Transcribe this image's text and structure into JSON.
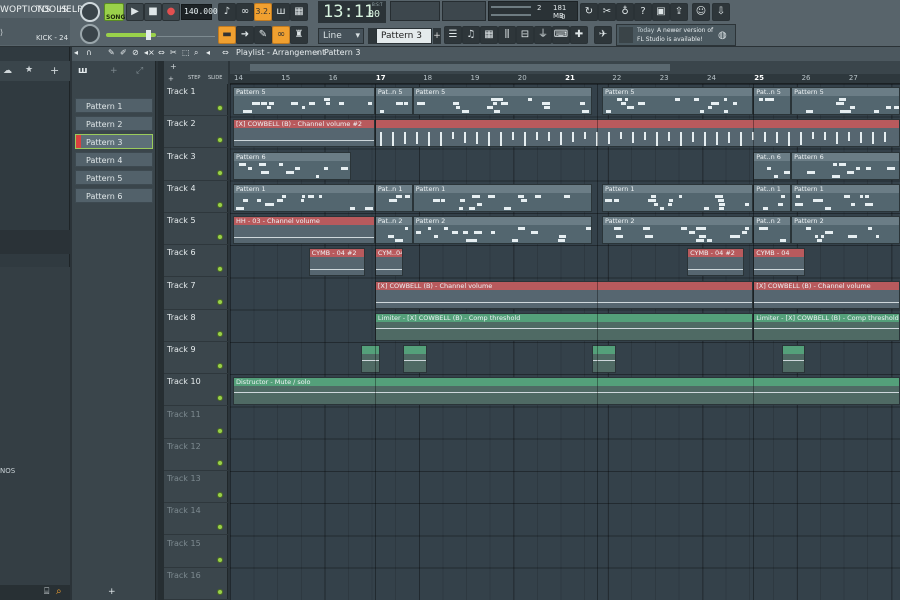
{
  "menu": {
    "view": "W",
    "options": "OPTIONS",
    "tools": "TOOLS",
    "help": "HELP"
  },
  "transport": {
    "song_label": "SONG",
    "tempo": "140.000",
    "time": "13:11",
    "time_sub": "00",
    "time_unit": "B:S:T"
  },
  "monitor": {
    "voices": "2",
    "memory": "181 MB",
    "cpu_val": "0"
  },
  "hint_bar": {
    "channel": "KICK - 24"
  },
  "snap": {
    "mode": "Line"
  },
  "pattern_select": {
    "current": "Pattern 3"
  },
  "news": {
    "prefix": "Today",
    "line1": "A newer version of",
    "line2": "FL Studio is available!"
  },
  "playlist": {
    "title": "Playlist - Arrangement",
    "title_sep": "›",
    "title_pattern": "Pattern 3",
    "step": "STEP",
    "slide": "SLIDE",
    "bars": [
      "14",
      "15",
      "16",
      "17",
      "18",
      "19",
      "20",
      "21",
      "22",
      "23",
      "24",
      "25",
      "26",
      "27"
    ],
    "patterns": [
      "Pattern 1",
      "Pattern 2",
      "Pattern 3",
      "Pattern 4",
      "Pattern 5",
      "Pattern 6"
    ],
    "active_pattern": 2,
    "tracks": [
      "Track 1",
      "Track 2",
      "Track 3",
      "Track 4",
      "Track 5",
      "Track 6",
      "Track 7",
      "Track 8",
      "Track 9",
      "Track 10",
      "Track 11",
      "Track 12",
      "Track 13",
      "Track 14",
      "Track 15",
      "Track 16"
    ],
    "clips": [
      {
        "track": 0,
        "start": 14.0,
        "end": 17.0,
        "label": "Pattern 5",
        "style": "pattern"
      },
      {
        "track": 0,
        "start": 17.0,
        "end": 17.8,
        "label": "Pat..n 5",
        "style": "pattern"
      },
      {
        "track": 0,
        "start": 17.8,
        "end": 21.6,
        "label": "Pattern 5",
        "style": "pattern"
      },
      {
        "track": 0,
        "start": 21.8,
        "end": 25.0,
        "label": "Pattern 5",
        "style": "pattern"
      },
      {
        "track": 0,
        "start": 25.0,
        "end": 25.8,
        "label": "Pat..n 5",
        "style": "pattern"
      },
      {
        "track": 0,
        "start": 25.8,
        "end": 28.5,
        "label": "Pattern 5",
        "style": "pattern"
      },
      {
        "track": 1,
        "start": 14.0,
        "end": 17.0,
        "label": "[X] COWBELL (B) - Channel volume #2",
        "style": "red"
      },
      {
        "track": 1,
        "start": 17.0,
        "end": 28.5,
        "label": "",
        "style": "red"
      },
      {
        "track": 2,
        "start": 14.0,
        "end": 16.5,
        "label": "Pattern 6",
        "style": "pattern"
      },
      {
        "track": 2,
        "start": 25.0,
        "end": 25.8,
        "label": "Pat..n 6",
        "style": "pattern"
      },
      {
        "track": 2,
        "start": 25.8,
        "end": 28.5,
        "label": "Pattern 6",
        "style": "pattern"
      },
      {
        "track": 3,
        "start": 14.0,
        "end": 17.0,
        "label": "Pattern 1",
        "style": "pattern"
      },
      {
        "track": 3,
        "start": 17.0,
        "end": 17.8,
        "label": "Pat..n 1",
        "style": "pattern"
      },
      {
        "track": 3,
        "start": 17.8,
        "end": 21.6,
        "label": "Pattern 1",
        "style": "pattern"
      },
      {
        "track": 3,
        "start": 21.8,
        "end": 25.0,
        "label": "Pattern 1",
        "style": "pattern"
      },
      {
        "track": 3,
        "start": 25.0,
        "end": 25.8,
        "label": "Pat..n 1",
        "style": "pattern"
      },
      {
        "track": 3,
        "start": 25.8,
        "end": 28.5,
        "label": "Pattern 1",
        "style": "pattern"
      },
      {
        "track": 4,
        "start": 14.0,
        "end": 17.0,
        "label": "HH - 03 - Channel volume",
        "style": "red"
      },
      {
        "track": 4,
        "start": 17.0,
        "end": 17.8,
        "label": "Pat..n 2",
        "style": "pattern"
      },
      {
        "track": 4,
        "start": 17.8,
        "end": 21.6,
        "label": "Pattern 2",
        "style": "pattern"
      },
      {
        "track": 4,
        "start": 21.8,
        "end": 25.0,
        "label": "Pattern 2",
        "style": "pattern"
      },
      {
        "track": 4,
        "start": 25.0,
        "end": 25.8,
        "label": "Pat..n 2",
        "style": "pattern"
      },
      {
        "track": 4,
        "start": 25.8,
        "end": 28.5,
        "label": "Pattern 2",
        "style": "pattern"
      },
      {
        "track": 5,
        "start": 15.6,
        "end": 16.8,
        "label": "CYMB - 04 #2",
        "style": "red"
      },
      {
        "track": 5,
        "start": 17.0,
        "end": 17.6,
        "label": "CYM..04",
        "style": "red"
      },
      {
        "track": 5,
        "start": 23.6,
        "end": 24.8,
        "label": "CYMB - 04 #2",
        "style": "red"
      },
      {
        "track": 5,
        "start": 25.0,
        "end": 26.1,
        "label": "CYMB - 04",
        "style": "red"
      },
      {
        "track": 6,
        "start": 17.0,
        "end": 25.0,
        "label": "[X] COWBELL (B) - Channel volume",
        "style": "red"
      },
      {
        "track": 6,
        "start": 25.0,
        "end": 28.5,
        "label": "[X] COWBELL (B) - Channel volume",
        "style": "red"
      },
      {
        "track": 7,
        "start": 17.0,
        "end": 25.0,
        "label": "Limiter - [X] COWBELL (B) - Comp threshold",
        "style": "green"
      },
      {
        "track": 7,
        "start": 25.0,
        "end": 28.5,
        "label": "Limiter - [X] COWBELL (B) - Comp threshold",
        "style": "green"
      },
      {
        "track": 8,
        "start": 16.7,
        "end": 17.1,
        "label": "",
        "style": "green"
      },
      {
        "track": 8,
        "start": 17.6,
        "end": 18.1,
        "label": "",
        "style": "green"
      },
      {
        "track": 8,
        "start": 21.6,
        "end": 22.1,
        "label": "",
        "style": "green"
      },
      {
        "track": 8,
        "start": 25.6,
        "end": 26.1,
        "label": "",
        "style": "green"
      },
      {
        "track": 9,
        "start": 14.0,
        "end": 28.5,
        "label": "Distructor - Mute / solo",
        "style": "green"
      }
    ]
  },
  "colors": {
    "accent": "#9acb5c",
    "clip_red": "#b85a5d",
    "clip_green": "#54a07a",
    "transport_orange": "#f0a030"
  }
}
